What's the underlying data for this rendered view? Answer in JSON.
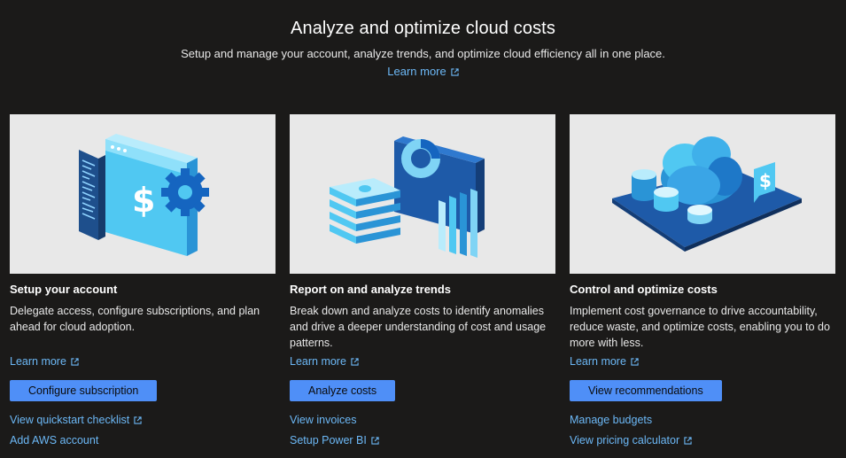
{
  "hero": {
    "title": "Analyze and optimize cloud costs",
    "subtitle": "Setup and manage your account, analyze trends, and optimize cloud efficiency all in one place.",
    "learn_more": "Learn more"
  },
  "cards": [
    {
      "title": "Setup your account",
      "description": "Delegate access, configure subscriptions, and plan ahead for cloud adoption.",
      "learn_more": "Learn more",
      "button": "Configure subscription",
      "link1": "View quickstart checklist",
      "link2": "Add AWS account",
      "illustration": "account-setup-illustration"
    },
    {
      "title": "Report on and analyze trends",
      "description": "Break down and analyze costs to identify anomalies and drive a deeper understanding of cost and usage patterns.",
      "learn_more": "Learn more",
      "button": "Analyze costs",
      "link1": "View invoices",
      "link2": "Setup Power BI",
      "illustration": "trends-report-illustration"
    },
    {
      "title": "Control and optimize costs",
      "description": "Implement cost governance to drive accountability, reduce waste, and optimize costs, enabling you to do more with less.",
      "learn_more": "Learn more",
      "button": "View recommendations",
      "link1": "Manage budgets",
      "link2": "View pricing calculator",
      "illustration": "cost-optimization-illustration"
    }
  ],
  "colors": {
    "background": "#1b1a19",
    "link": "#6cb8f6",
    "button": "#4f8ff7",
    "card_image_bg": "#e8e8e8"
  },
  "icons": {
    "external_link": "external-link-icon"
  }
}
